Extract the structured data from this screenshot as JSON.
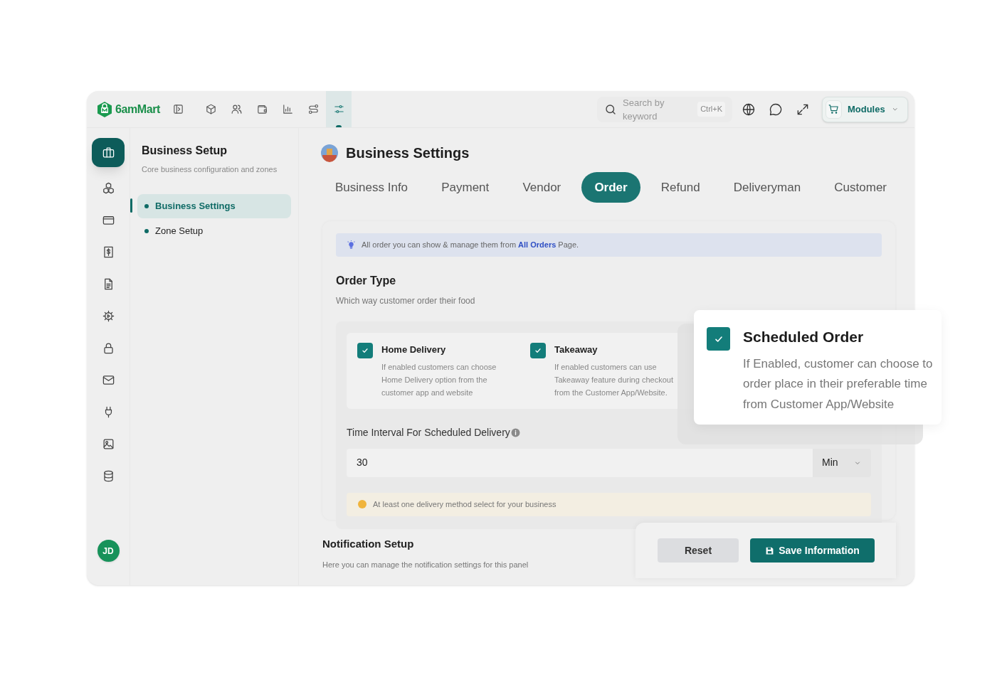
{
  "brand": {
    "name": "6amMart"
  },
  "top_nav": [
    {
      "kind": "panel",
      "selected": false
    },
    {
      "kind": "box",
      "selected": false
    },
    {
      "kind": "users",
      "selected": false
    },
    {
      "kind": "wallet",
      "selected": false
    },
    {
      "kind": "chart",
      "selected": false
    },
    {
      "kind": "route",
      "selected": false
    },
    {
      "kind": "sliders",
      "selected": true
    }
  ],
  "search": {
    "placeholder": "Search by keyword",
    "shortcut": "Ctrl+K"
  },
  "top_actions": [
    {
      "kind": "globe"
    },
    {
      "kind": "chat"
    },
    {
      "kind": "expand"
    }
  ],
  "modules_button": {
    "label": "Modules"
  },
  "rail": [
    {
      "kind": "briefcase",
      "selected": true
    },
    {
      "kind": "cubes",
      "selected": false
    },
    {
      "kind": "card",
      "selected": false
    },
    {
      "kind": "receipt",
      "selected": false
    },
    {
      "kind": "file",
      "selected": false
    },
    {
      "kind": "gear",
      "selected": false
    },
    {
      "kind": "lock",
      "selected": false
    },
    {
      "kind": "mail",
      "selected": false
    },
    {
      "kind": "plug",
      "selected": false
    },
    {
      "kind": "image",
      "selected": false
    },
    {
      "kind": "database",
      "selected": false
    }
  ],
  "avatar": {
    "initials": "JD"
  },
  "side_panel": {
    "title": "Business Setup",
    "subtitle": "Core business configuration and zones",
    "items": [
      {
        "label": "Business Settings",
        "selected": true
      },
      {
        "label": "Zone Setup",
        "selected": false
      }
    ]
  },
  "page": {
    "title": "Business Settings"
  },
  "tabs": [
    {
      "label": "Business Info",
      "selected": false
    },
    {
      "label": "Payment",
      "selected": false
    },
    {
      "label": "Vendor",
      "selected": false
    },
    {
      "label": "Order",
      "selected": true
    },
    {
      "label": "Refund",
      "selected": false
    },
    {
      "label": "Deliveryman",
      "selected": false
    },
    {
      "label": "Customer",
      "selected": false
    }
  ],
  "info_banner": {
    "text": "All order you can show & manage them from",
    "link": "All Orders",
    "text_after": "Page."
  },
  "order_type": {
    "title": "Order Type",
    "subtitle": "Which way customer order their food",
    "options": [
      {
        "label": "Home Delivery",
        "description": "If enabled customers can choose Home Delivery option from the customer app and website",
        "checked": true
      },
      {
        "label": "Takeaway",
        "description": "If enabled customers can use Takeaway feature during checkout from the Customer App/Website.",
        "checked": true
      }
    ]
  },
  "time_interval": {
    "label": "Time Interval For Scheduled Delivery",
    "value": "30",
    "unit": "Min"
  },
  "warning": {
    "text": "At least one delivery method select for your business"
  },
  "notification": {
    "title": "Notification Setup",
    "subtitle": "Here you can manage the notification settings for this panel"
  },
  "buttons": {
    "reset": "Reset",
    "save": "Save Information"
  },
  "scheduled_order": {
    "label": "Scheduled Order",
    "description": "If Enabled, customer can choose to order place in their preferable time from Customer App/Website",
    "checked": true
  }
}
